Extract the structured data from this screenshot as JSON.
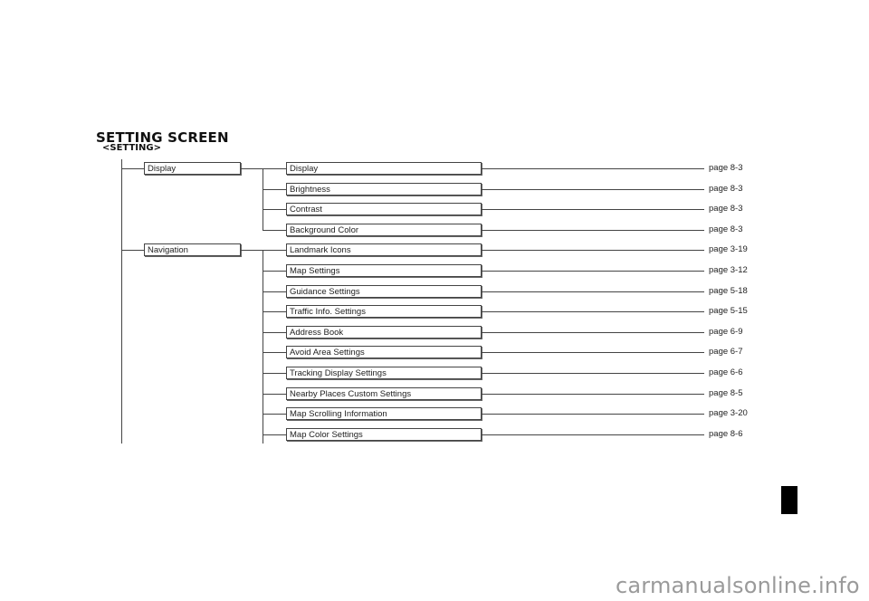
{
  "header": {
    "title": "SETTING SCREEN",
    "subtitle": "<SETTING>"
  },
  "tree": {
    "groups": [
      {
        "label": "Display",
        "items": [
          {
            "label": "Display",
            "page": "page 8-3"
          },
          {
            "label": "Brightness",
            "page": "page 8-3"
          },
          {
            "label": "Contrast",
            "page": "page 8-3"
          },
          {
            "label": "Background Color",
            "page": "page 8-3"
          }
        ]
      },
      {
        "label": "Navigation",
        "items": [
          {
            "label": "Landmark Icons",
            "page": "page 3-19"
          },
          {
            "label": "Map Settings",
            "page": "page 3-12"
          },
          {
            "label": "Guidance Settings",
            "page": "page 5-18"
          },
          {
            "label": "Traffic Info. Settings",
            "page": "page 5-15"
          },
          {
            "label": "Address Book",
            "page": "page 6-9"
          },
          {
            "label": "Avoid Area Settings",
            "page": "page 6-7"
          },
          {
            "label": "Tracking Display Settings",
            "page": "page 6-6"
          },
          {
            "label": "Nearby Places Custom Settings",
            "page": "page 8-5"
          },
          {
            "label": "Map Scrolling Information",
            "page": "page 3-20"
          },
          {
            "label": "Map Color Settings",
            "page": "page 8-6"
          }
        ]
      }
    ]
  },
  "watermark": "carmanualsonline.info"
}
